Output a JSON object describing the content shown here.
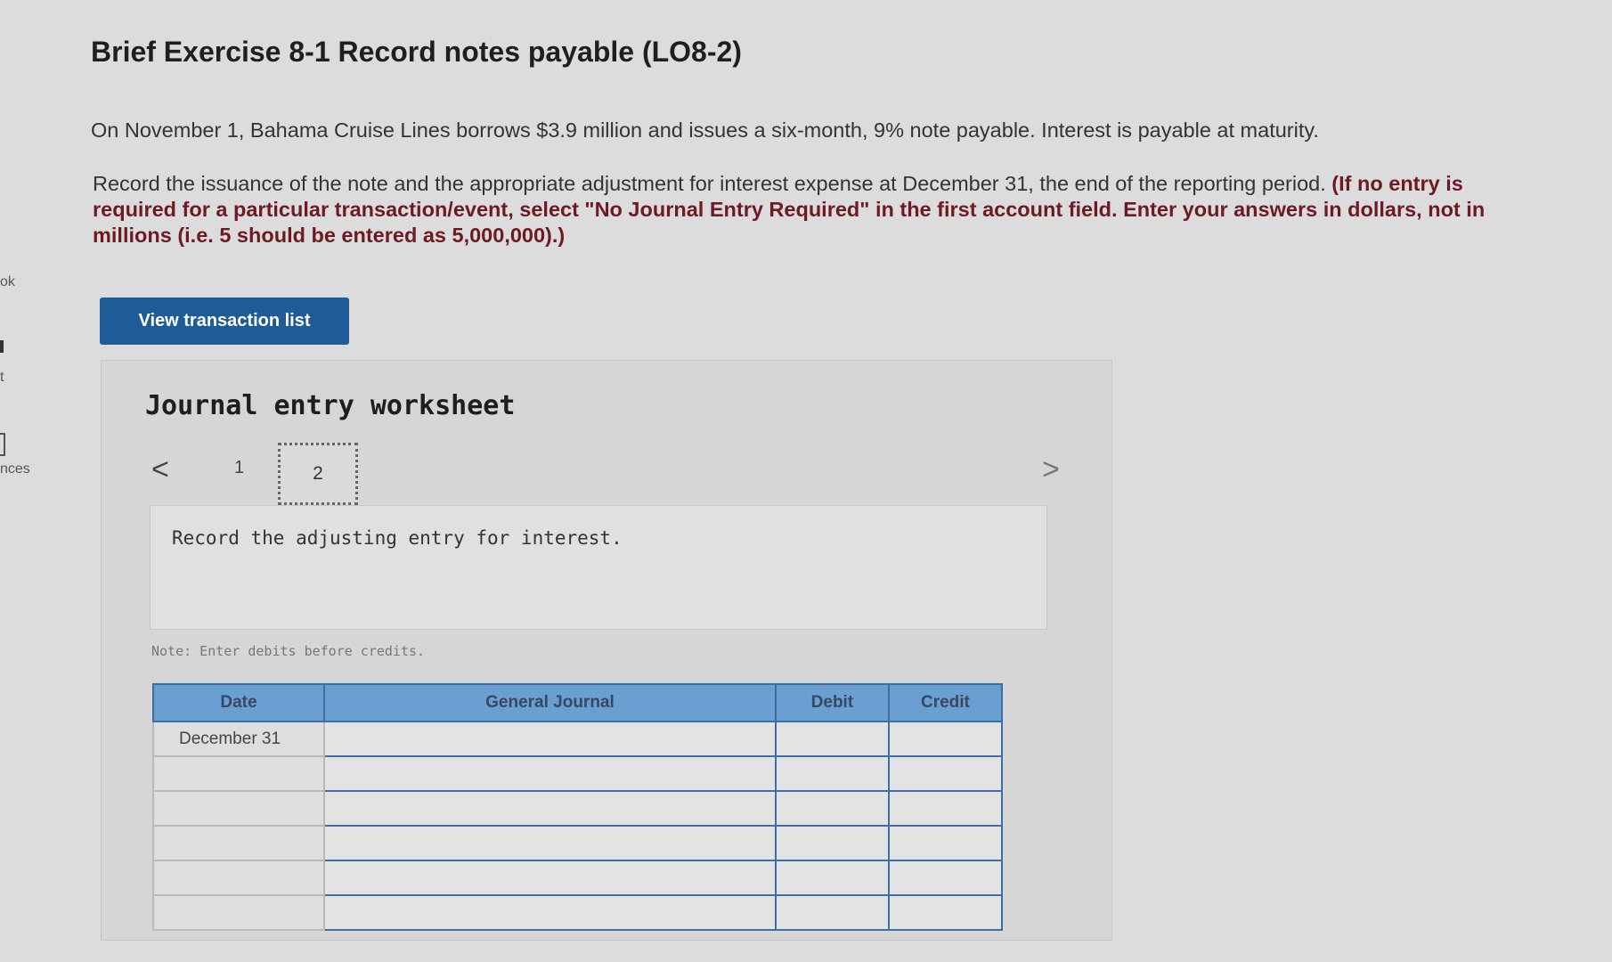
{
  "side_fragments": [
    "ok",
    "t",
    "nces"
  ],
  "header": {
    "title": "Brief Exercise 8-1 Record notes payable (LO8-2)"
  },
  "problem": {
    "paragraph1": "On November 1, Bahama Cruise Lines borrows $3.9 million and issues a six-month, 9% note payable. Interest is payable at maturity.",
    "paragraph2": "Record the issuance of the note and the appropriate adjustment for interest expense at December 31, the end of the reporting period.",
    "instruction": "(If no entry is required for a particular transaction/event, select \"No Journal Entry Required\" in the first account field. Enter your answers in dollars, not in millions (i.e. 5 should be entered as 5,000,000).)"
  },
  "view_transaction_button": "View transaction list",
  "worksheet": {
    "title": "Journal entry worksheet",
    "prev_glyph": "<",
    "next_glyph": ">",
    "pages": [
      "1",
      "2"
    ],
    "active_page": "2",
    "prompt": "Record the adjusting entry for interest.",
    "note": "Note: Enter debits before credits."
  },
  "journal": {
    "columns": [
      "Date",
      "General Journal",
      "Debit",
      "Credit"
    ],
    "rows": [
      {
        "date": "December 31",
        "account": "",
        "debit": "",
        "credit": ""
      },
      {
        "date": "",
        "account": "",
        "debit": "",
        "credit": ""
      },
      {
        "date": "",
        "account": "",
        "debit": "",
        "credit": ""
      },
      {
        "date": "",
        "account": "",
        "debit": "",
        "credit": ""
      },
      {
        "date": "",
        "account": "",
        "debit": "",
        "credit": ""
      },
      {
        "date": "",
        "account": "",
        "debit": "",
        "credit": ""
      }
    ]
  }
}
